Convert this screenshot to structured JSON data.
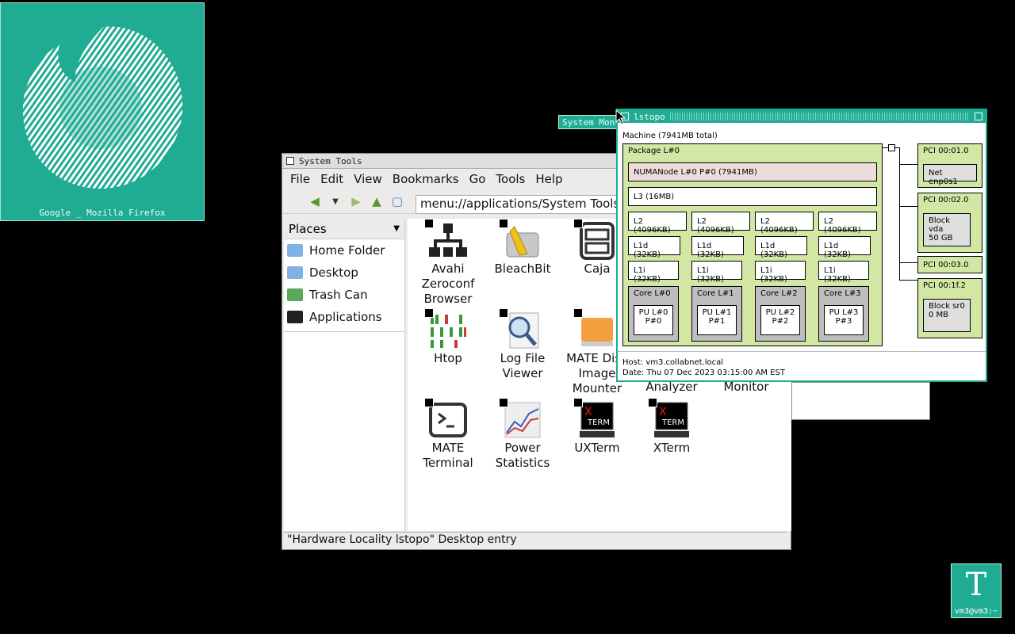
{
  "firefox_icon": {
    "caption": "Google _ Mozilla Firefox",
    "color": "#20ab93"
  },
  "terminal_icon": {
    "caption": "vm3@vm3:~",
    "glyph": "T"
  },
  "system_monitor": {
    "title": "System Monitor"
  },
  "caja": {
    "title": "System Tools",
    "menu": [
      "File",
      "Edit",
      "View",
      "Bookmarks",
      "Go",
      "Tools",
      "Help"
    ],
    "location": "menu://applications/System Tools",
    "places_header": "Places",
    "places": [
      "Home Folder",
      "Desktop",
      "Trash Can",
      "Applications"
    ],
    "apps": [
      {
        "label": "Avahi Zeroconf Browser",
        "icon": "network-icon"
      },
      {
        "label": "BleachBit",
        "icon": "broom-icon"
      },
      {
        "label": "Caja",
        "icon": "file-cabinet-icon"
      },
      {
        "label": "Htop",
        "icon": "htop-bars-icon"
      },
      {
        "label": "Log File Viewer",
        "icon": "magnifier-icon"
      },
      {
        "label": "MATE Disk Image Mounter",
        "icon": "disk-image-icon"
      },
      {
        "label": "Analyzer",
        "icon": "disk-analyzer-icon"
      },
      {
        "label": "Monitor",
        "icon": "monitor-icon"
      },
      {
        "label": "MATE Terminal",
        "icon": "terminal-icon"
      },
      {
        "label": "Power Statistics",
        "icon": "chart-icon"
      },
      {
        "label": "UXTerm",
        "icon": "xterm-icon"
      },
      {
        "label": "XTerm",
        "icon": "xterm-icon"
      }
    ],
    "status": "\"Hardware Locality lstopo\" Desktop entry"
  },
  "lstopo": {
    "title": "lstopo",
    "machine": "Machine (7941MB total)",
    "package": "Package L#0",
    "numa": "NUMANode L#0 P#0 (7941MB)",
    "l3": "L3 (16MB)",
    "l2": [
      "L2 (4096KB)",
      "L2 (4096KB)",
      "L2 (4096KB)",
      "L2 (4096KB)"
    ],
    "l1d": [
      "L1d (32KB)",
      "L1d (32KB)",
      "L1d (32KB)",
      "L1d (32KB)"
    ],
    "l1i": [
      "L1i (32KB)",
      "L1i (32KB)",
      "L1i (32KB)",
      "L1i (32KB)"
    ],
    "cores": [
      "Core L#0",
      "Core L#1",
      "Core L#2",
      "Core L#3"
    ],
    "pus": [
      [
        "PU L#0",
        "P#0"
      ],
      [
        "PU L#1",
        "P#1"
      ],
      [
        "PU L#2",
        "P#2"
      ],
      [
        "PU L#3",
        "P#3"
      ]
    ],
    "pci": [
      {
        "label": "PCI 00:01.0",
        "device": "Net enp0s1"
      },
      {
        "label": "PCI 00:02.0",
        "device": "Block vda",
        "device2": "50 GB"
      },
      {
        "label": "PCI 00:03.0"
      },
      {
        "label": "PCI 00:1f.2",
        "device": "Block sr0",
        "device2": "0 MB"
      }
    ],
    "host": "Host: vm3.collabnet.local",
    "date": "Date: Thu 07 Dec 2023 03:15:00 AM EST"
  }
}
